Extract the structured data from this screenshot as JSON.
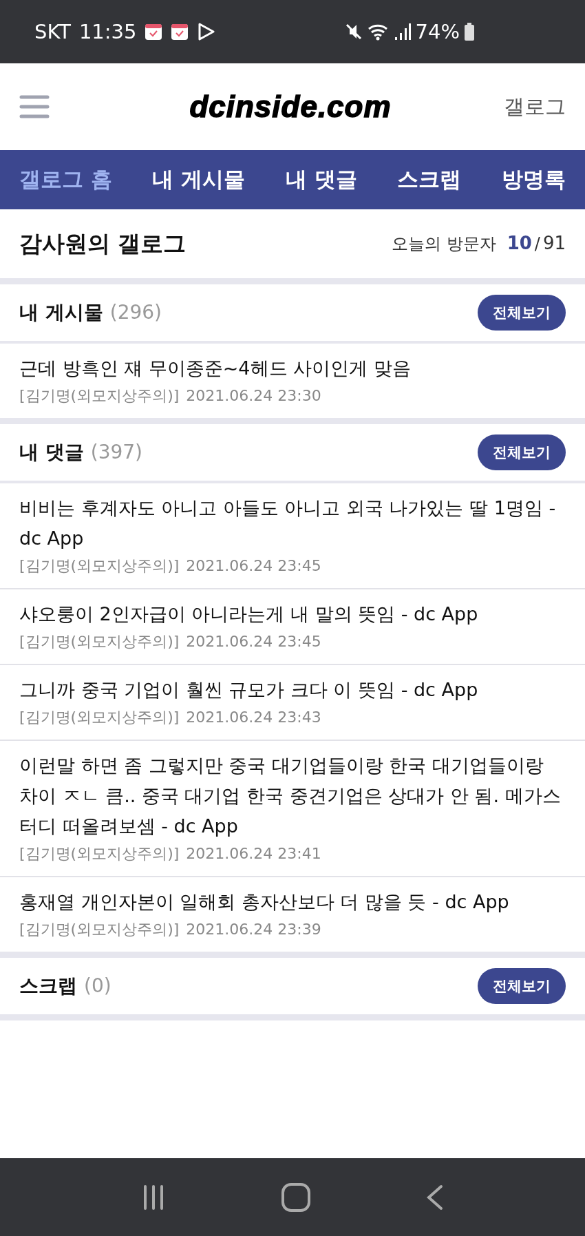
{
  "status_bar": {
    "carrier": "SKT",
    "time": "11:35",
    "battery": "74%"
  },
  "header": {
    "logo": "dcinside.com",
    "link": "갤로그"
  },
  "tabs": [
    {
      "label": "갤로그 홈",
      "selected": true
    },
    {
      "label": "내 게시물",
      "selected": false
    },
    {
      "label": "내 댓글",
      "selected": false
    },
    {
      "label": "스크랩",
      "selected": false
    },
    {
      "label": "방명록",
      "selected": false
    }
  ],
  "gallog": {
    "title": "감사원의 갤로그",
    "visitor_label": "오늘의 방문자",
    "visitors_today": "10",
    "separator": "/",
    "visitors_total": "91"
  },
  "sections": [
    {
      "heading": "내 게시물",
      "count": "(296)",
      "button": "전체보기",
      "items": [
        {
          "text": "근데 방흑인 쟤 무이종준~4헤드 사이인게 맞음",
          "author": "[김기명(외모지상주의)]",
          "date": "2021.06.24 23:30"
        }
      ]
    },
    {
      "heading": "내 댓글",
      "count": "(397)",
      "button": "전체보기",
      "items": [
        {
          "text": "비비는 후계자도 아니고 아들도 아니고 외국 나가있는 딸 1명임 - dc App",
          "author": "[김기명(외모지상주의)]",
          "date": "2021.06.24 23:45"
        },
        {
          "text": "샤오룽이 2인자급이 아니라는게 내 말의 뜻임 - dc App",
          "author": "[김기명(외모지상주의)]",
          "date": "2021.06.24 23:45"
        },
        {
          "text": "그니까 중국 기업이 훨씬 규모가 크다 이 뜻임 - dc App",
          "author": "[김기명(외모지상주의)]",
          "date": "2021.06.24 23:43"
        },
        {
          "text": "이런말 하면 좀 그렇지만 중국 대기업들이랑 한국 대기업들이랑 차이 ㅈㄴ 큼.. 중국 대기업 한국 중견기업은 상대가 안 됨. 메가스터디 떠올려보셈 - dc App",
          "author": "[김기명(외모지상주의)]",
          "date": "2021.06.24 23:41"
        },
        {
          "text": "홍재열 개인자본이 일해회 총자산보다 더 많을 듯 - dc App",
          "author": "[김기명(외모지상주의)]",
          "date": "2021.06.24 23:39"
        }
      ]
    },
    {
      "heading": "스크랩",
      "count": "(0)",
      "button": "전체보기"
    }
  ]
}
